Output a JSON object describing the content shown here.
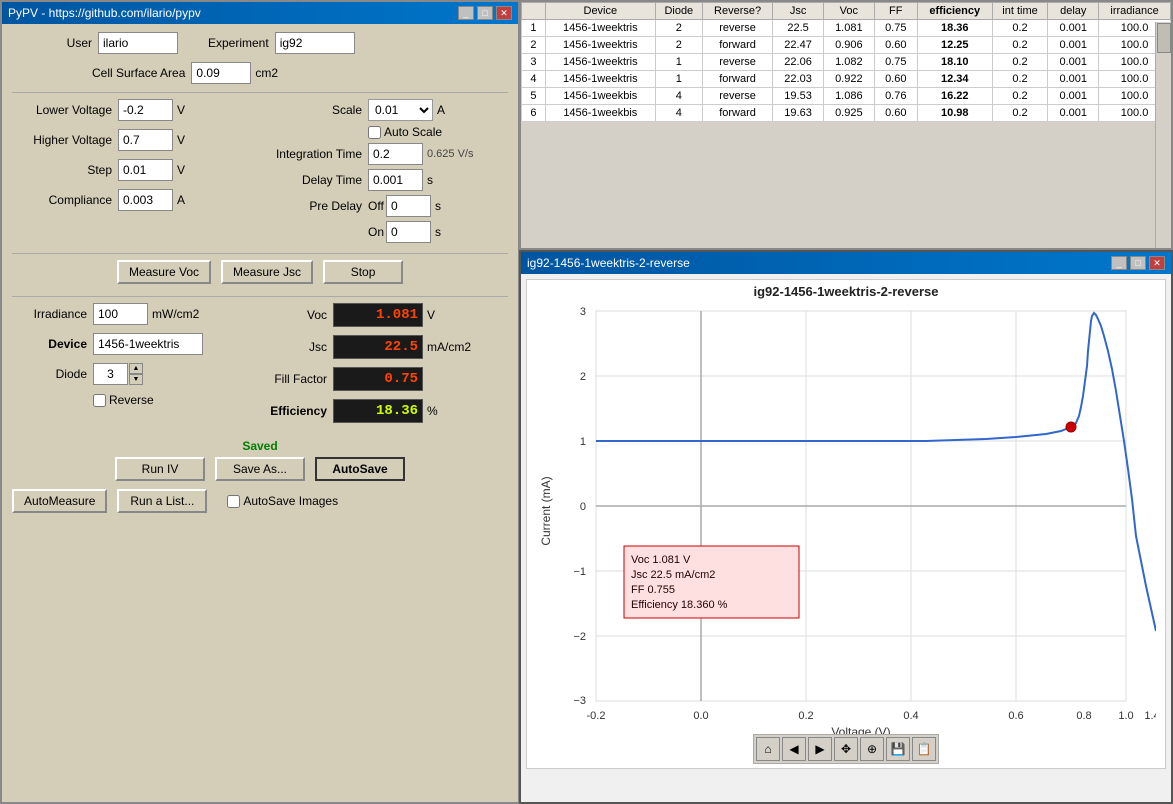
{
  "app": {
    "title": "PyPV - https://github.com/ilario/pypv",
    "graph_title": "ig92-1456-1weektris-2-reverse",
    "graph_window_title": "ig92-1456-1weektris-2-reverse"
  },
  "left_panel": {
    "user_label": "User",
    "user_value": "ilario",
    "experiment_label": "Experiment",
    "experiment_value": "ig92",
    "cell_surface_area_label": "Cell Surface Area",
    "cell_surface_area_value": "0.09",
    "cell_surface_area_unit": "cm2",
    "lower_voltage_label": "Lower Voltage",
    "lower_voltage_value": "-0.2",
    "lower_voltage_unit": "V",
    "higher_voltage_label": "Higher Voltage",
    "higher_voltage_value": "0.7",
    "higher_voltage_unit": "V",
    "step_label": "Step",
    "step_value": "0.01",
    "step_unit": "V",
    "compliance_label": "Compliance",
    "compliance_value": "0.003",
    "compliance_unit": "A",
    "scale_label": "Scale",
    "scale_value": "0.01",
    "scale_unit": "A",
    "auto_scale_label": "Auto Scale",
    "integration_time_label": "Integration Time",
    "integration_time_value": "0.2",
    "sweep_rate": "0.625 V/s",
    "delay_time_label": "Delay Time",
    "delay_time_value": "0.001",
    "delay_time_unit": "s",
    "pre_delay_label": "Pre Delay",
    "pre_delay_off_label": "Off",
    "pre_delay_off_value": "0",
    "pre_delay_off_unit": "s",
    "pre_delay_on_label": "On",
    "pre_delay_on_value": "0",
    "pre_delay_on_unit": "s",
    "measure_voc_btn": "Measure Voc",
    "measure_jsc_btn": "Measure Jsc",
    "stop_btn": "Stop",
    "irradiance_label": "Irradiance",
    "irradiance_value": "100",
    "irradiance_unit": "mW/cm2",
    "voc_label": "Voc",
    "voc_value": "1.081",
    "voc_unit": "V",
    "device_label": "Device",
    "device_value": "1456-1weektris",
    "jsc_label": "Jsc",
    "jsc_value": "22.5",
    "jsc_unit": "mA/cm2",
    "diode_label": "Diode",
    "diode_value": "3",
    "fill_factor_label": "Fill Factor",
    "fill_factor_value": "0.75",
    "efficiency_label": "Efficiency",
    "efficiency_value": "18.36",
    "efficiency_unit": "%",
    "reverse_label": "Reverse",
    "reverse_checked": false,
    "saved_text": "Saved",
    "run_iv_btn": "Run IV",
    "save_as_btn": "Save As...",
    "autosave_btn": "AutoSave",
    "automeasure_btn": "AutoMeasure",
    "run_a_list_btn": "Run a List...",
    "autosave_images_label": "AutoSave Images",
    "autosave_images_checked": false
  },
  "table": {
    "headers": [
      "",
      "Device",
      "Diode",
      "Reverse?",
      "Jsc",
      "Voc",
      "FF",
      "efficiency",
      "int time",
      "delay",
      "irradiance"
    ],
    "rows": [
      [
        "1",
        "1456-1weektris",
        "2",
        "reverse",
        "22.5",
        "1.081",
        "0.75",
        "18.36",
        "0.2",
        "0.001",
        "100.0"
      ],
      [
        "2",
        "1456-1weektris",
        "2",
        "forward",
        "22.47",
        "0.906",
        "0.60",
        "12.25",
        "0.2",
        "0.001",
        "100.0"
      ],
      [
        "3",
        "1456-1weektris",
        "1",
        "reverse",
        "22.06",
        "1.082",
        "0.75",
        "18.10",
        "0.2",
        "0.001",
        "100.0"
      ],
      [
        "4",
        "1456-1weektris",
        "1",
        "forward",
        "22.03",
        "0.922",
        "0.60",
        "12.34",
        "0.2",
        "0.001",
        "100.0"
      ],
      [
        "5",
        "1456-1weekbis",
        "4",
        "reverse",
        "19.53",
        "1.086",
        "0.76",
        "16.22",
        "0.2",
        "0.001",
        "100.0"
      ],
      [
        "6",
        "1456-1weekbis",
        "4",
        "forward",
        "19.63",
        "0.925",
        "0.60",
        "10.98",
        "0.2",
        "0.001",
        "100.0"
      ]
    ]
  },
  "graph": {
    "x_label": "Voltage (V)",
    "y_label": "Current (mA)",
    "x_min": "-0.2",
    "x_max": "1.4",
    "y_min": "-3",
    "y_max": "3",
    "tooltip": {
      "voc": "Voc 1.081 V",
      "jsc": "Jsc 22.5 mA/cm2",
      "ff": "FF 0.755",
      "efficiency": "Efficiency 18.360 %"
    }
  }
}
